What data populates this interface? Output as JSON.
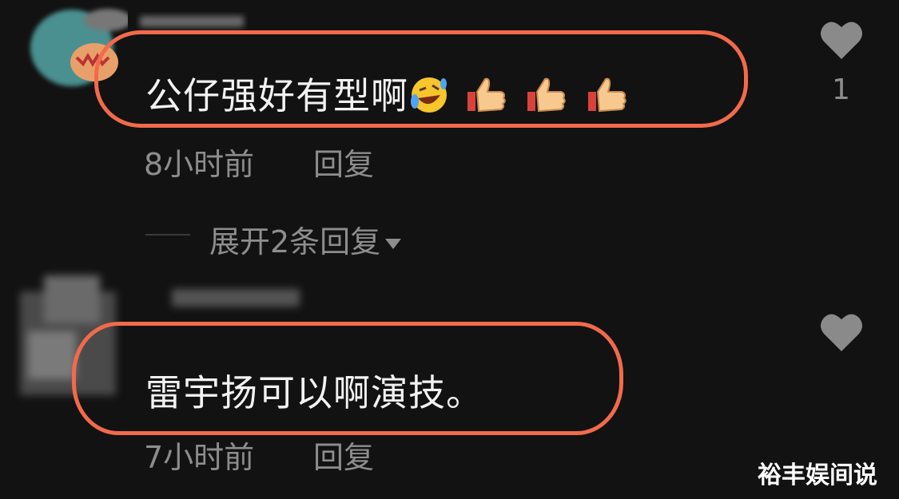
{
  "comments": [
    {
      "text": "公仔强好有型啊",
      "emojis": [
        "rofl-emoji",
        "thumbs-up-emoji",
        "thumbs-up-emoji",
        "thumbs-up-emoji"
      ],
      "time": "8小时前",
      "reply_label": "回复",
      "like_count": "1",
      "expand_replies_label": "展开2条回复"
    },
    {
      "text": "雷宇扬可以啊演技。",
      "time": "7小时前",
      "reply_label": "回复",
      "like_count": ""
    }
  ],
  "watermark": "裕丰娱间说",
  "colors": {
    "background": "#121212",
    "highlight_oval": "#f26a4b",
    "meta_text": "#8d8d8d",
    "comment_text": "#f2f2f2"
  }
}
